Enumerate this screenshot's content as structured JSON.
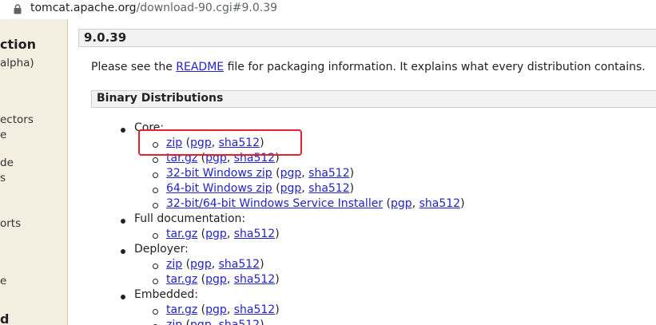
{
  "browser": {
    "url_host": "tomcat.apache.org",
    "url_path": "/download-90.cgi#9.0.39"
  },
  "sidebar": {
    "items": [
      "ction",
      "alpha)",
      "ectors",
      "e",
      "de",
      "s",
      "orts",
      "e",
      "d"
    ]
  },
  "version_heading": "9.0.39",
  "intro": {
    "before": "Please see the ",
    "link": "README",
    "after": " file for packaging information. It explains what every distribution contains."
  },
  "section_heading": "Binary Distributions",
  "categories": {
    "core": "Core:",
    "full_doc": "Full documentation:",
    "deployer": "Deployer:",
    "embedded": "Embedded:"
  },
  "links": {
    "zip": "zip",
    "tar_gz": "tar.gz",
    "win32": "32-bit Windows zip",
    "win64": "64-bit Windows zip",
    "installer": "32-bit/64-bit Windows Service Installer",
    "pgp": "pgp",
    "sha512": "sha512"
  },
  "punct": {
    "open": " (",
    "comma": ", ",
    "close": ")"
  },
  "colors": {
    "link": "#2323c8",
    "highlight": "#e0242b",
    "sidebar_bg": "#f5efe1"
  }
}
